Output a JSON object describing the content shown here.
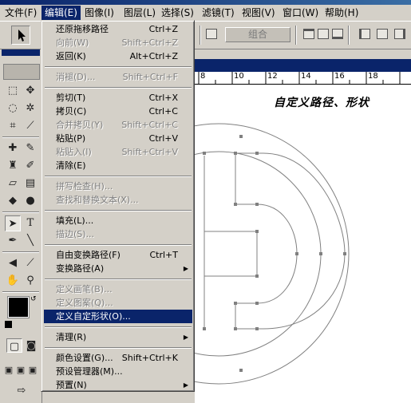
{
  "menubar": {
    "items": [
      "文件(F)",
      "编辑(E)",
      "图像(I)",
      "图层(L)",
      "选择(S)",
      "滤镜(T)",
      "视图(V)",
      "窗口(W)",
      "帮助(H)"
    ]
  },
  "options": {
    "combine_label": "组合"
  },
  "ruler": {
    "ticks": [
      "8",
      "10",
      "12",
      "14",
      "16",
      "18"
    ]
  },
  "document": {
    "heading": "自定义路径、形状"
  },
  "edit_menu": {
    "items": [
      {
        "label": "还原拖移路径",
        "shortcut": "Ctrl+Z",
        "enabled": true
      },
      {
        "label": "向前(W)",
        "shortcut": "Shift+Ctrl+Z",
        "enabled": false
      },
      {
        "label": "返回(K)",
        "shortcut": "Alt+Ctrl+Z",
        "enabled": true
      },
      {
        "label": "消褪(D)...",
        "shortcut": "Shift+Ctrl+F",
        "enabled": false
      },
      {
        "label": "剪切(T)",
        "shortcut": "Ctrl+X",
        "enabled": true
      },
      {
        "label": "拷贝(C)",
        "shortcut": "Ctrl+C",
        "enabled": true
      },
      {
        "label": "合并拷贝(Y)",
        "shortcut": "Shift+Ctrl+C",
        "enabled": false
      },
      {
        "label": "粘贴(P)",
        "shortcut": "Ctrl+V",
        "enabled": true
      },
      {
        "label": "粘贴入(I)",
        "shortcut": "Shift+Ctrl+V",
        "enabled": false
      },
      {
        "label": "清除(E)",
        "shortcut": "",
        "enabled": true
      },
      {
        "label": "拼写检查(H)...",
        "shortcut": "",
        "enabled": false
      },
      {
        "label": "查找和替换文本(X)...",
        "shortcut": "",
        "enabled": false
      },
      {
        "label": "填充(L)...",
        "shortcut": "",
        "enabled": true
      },
      {
        "label": "描边(S)...",
        "shortcut": "",
        "enabled": false
      },
      {
        "label": "自由变换路径(F)",
        "shortcut": "Ctrl+T",
        "enabled": true
      },
      {
        "label": "变换路径(A)",
        "shortcut": "",
        "enabled": true,
        "submenu": true
      },
      {
        "label": "定义画笔(B)...",
        "shortcut": "",
        "enabled": false
      },
      {
        "label": "定义图案(Q)...",
        "shortcut": "",
        "enabled": false
      },
      {
        "label": "定义自定形状(O)...",
        "shortcut": "",
        "enabled": true,
        "highlighted": true
      },
      {
        "label": "清理(R)",
        "shortcut": "",
        "enabled": true,
        "submenu": true
      },
      {
        "label": "颜色设置(G)...",
        "shortcut": "Shift+Ctrl+K",
        "enabled": true
      },
      {
        "label": "预设管理器(M)...",
        "shortcut": "",
        "enabled": true
      },
      {
        "label": "预置(N)",
        "shortcut": "",
        "enabled": true,
        "submenu": true
      }
    ]
  },
  "colors": {
    "menu_highlight": "#0a246a",
    "chrome": "#d4d0c8",
    "path_point": "#808080"
  }
}
